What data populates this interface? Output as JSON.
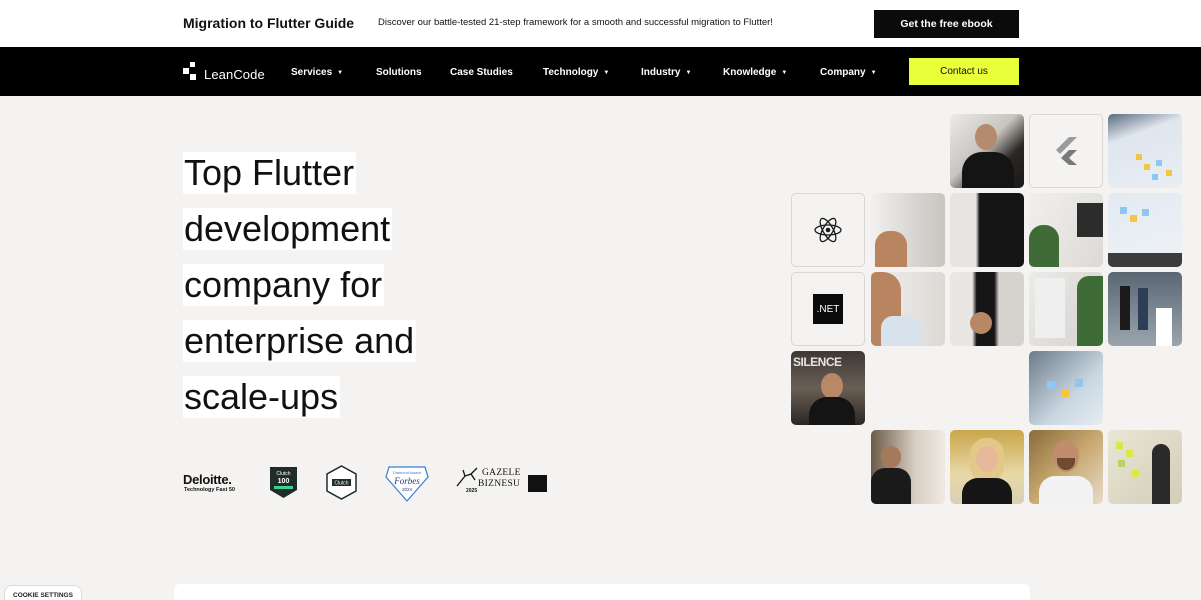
{
  "promo": {
    "title": "Migration to Flutter Guide",
    "text": "Discover our battle-tested 21-step framework for a smooth and successful migration to Flutter!",
    "button_label": "Get the free ebook"
  },
  "nav": {
    "logo_text": "LeanCode",
    "items": [
      {
        "label": "Services",
        "caret": "▼"
      },
      {
        "label": "Solutions"
      },
      {
        "label": "Case Studies"
      },
      {
        "label": "Technology",
        "caret": "▼"
      },
      {
        "label": "Industry",
        "caret": "▼"
      },
      {
        "label": "Knowledge",
        "caret": "▼"
      },
      {
        "label": "Company",
        "caret": "▼"
      }
    ],
    "contact_label": "Contact us"
  },
  "hero": {
    "lines": [
      "Top Flutter",
      "development",
      "company for",
      "enterprise and",
      "scale-ups"
    ]
  },
  "awards": {
    "deloitte_name": "Deloitte.",
    "deloitte_sub": "Technology Fast 50",
    "clutch100_top": "Clutch",
    "clutch100_num": "100",
    "clutch_label": "Clutch",
    "forbes_top": "Diamond Award",
    "forbes_name": "Forbes",
    "forbes_year": "2024",
    "gazele_line1": "GAZELE",
    "gazele_line2": "BIZNESU",
    "gazele_year": "2025"
  },
  "tech_logos": {
    "dotnet": ".NET"
  },
  "photos": {
    "silence_text": "SILENCE"
  },
  "cookie": {
    "label": "COOKIE SETTINGS"
  },
  "colors": {
    "accent": "#e8ff3a",
    "nav_bg": "#000000",
    "page_bg": "#f4f3f1",
    "react": "#1a1a1a"
  },
  "icons": [
    "leancode-logo-icon",
    "react-icon",
    "flutter-icon",
    "dotnet-icon"
  ]
}
